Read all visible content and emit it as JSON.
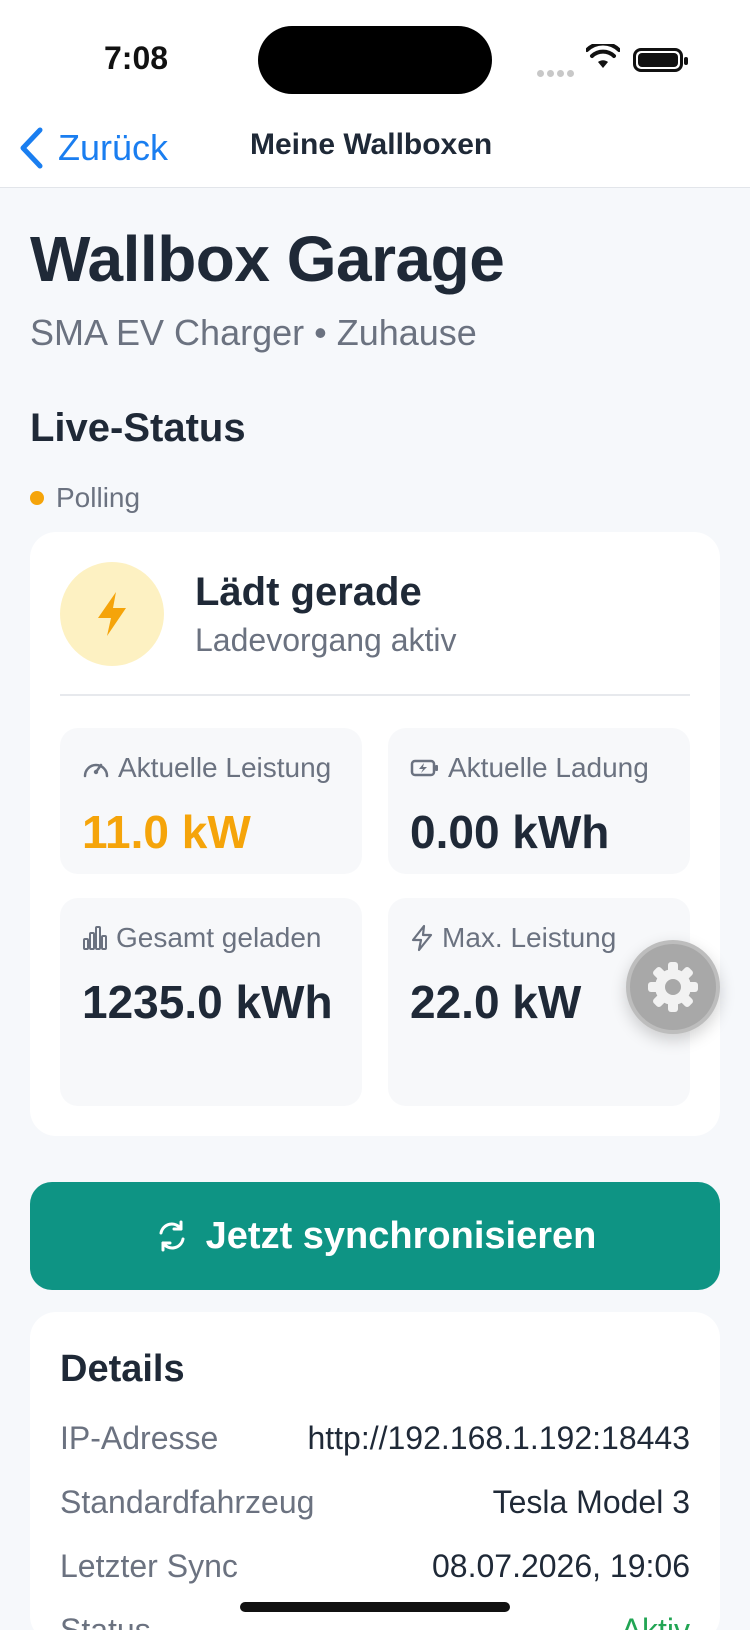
{
  "status_bar": {
    "time": "7:08"
  },
  "nav": {
    "back_label": "Zurück",
    "title": "Meine Wallboxen"
  },
  "header": {
    "title": "Wallbox Garage",
    "subtitle": "SMA EV Charger • Zuhause"
  },
  "live": {
    "section_title": "Live-Status",
    "connection": "Polling",
    "status_title": "Lädt gerade",
    "status_sub": "Ladevorgang aktiv",
    "accent_color": "#f5a40a",
    "tiles": [
      {
        "label": "Aktuelle Leistung",
        "value": "11.0 kW",
        "icon": "gauge-icon"
      },
      {
        "label": "Aktuelle Ladung",
        "value": "0.00 kWh",
        "icon": "battery-charging-icon"
      },
      {
        "label": "Gesamt geladen",
        "value": "1235.0 kWh",
        "icon": "bar-chart-icon"
      },
      {
        "label": "Max. Leistung",
        "value": "22.0 kW",
        "icon": "bolt-outline-icon"
      }
    ]
  },
  "actions": {
    "sync_label": "Jetzt synchronisieren",
    "sync_color": "#0e9484"
  },
  "details": {
    "title": "Details",
    "rows": [
      {
        "key": "IP-Adresse",
        "value": "http://192.168.1.192:18443"
      },
      {
        "key": "Standardfahrzeug",
        "value": "Tesla Model 3"
      },
      {
        "key": "Letzter Sync",
        "value": "08.07.2026, 19:06"
      },
      {
        "key": "Status",
        "value": "Aktiv"
      }
    ]
  }
}
